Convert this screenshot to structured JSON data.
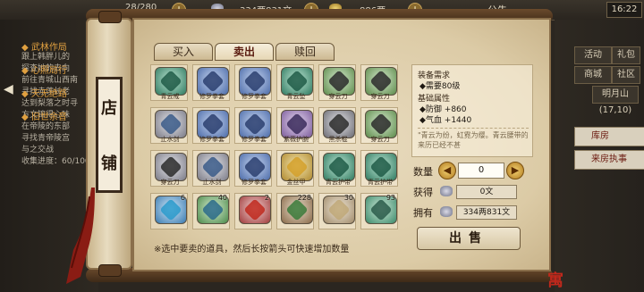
{
  "topbar": {
    "res1": "28/280",
    "money": "334两831文",
    "res3": "886两",
    "notice": "公告",
    "time": "16:22"
  },
  "quests": [
    {
      "title": "◆ 武林作局",
      "desc": "跟上韩胖儿的"
    },
    {
      "title": "",
      "desc": "探查她的去向"
    },
    {
      "title": "◆ 心照局行",
      "desc": "前往青城山西南"
    },
    {
      "title": "",
      "desc": "寻找赤莲长老"
    },
    {
      "title": "◆ 天无绝路",
      "desc": "达到梨落之时寻"
    },
    {
      "title": "",
      "desc": "方文锦得心味"
    },
    {
      "title": "◆ 旧世余音",
      "desc": "在帝陵的东部"
    },
    {
      "title": "",
      "desc": "寻找青帝陵宫"
    },
    {
      "title": "",
      "desc": "与之交战"
    },
    {
      "title": "",
      "desc": "收集进度：60/100"
    }
  ],
  "right_buttons": [
    "活动",
    "礼包",
    "商城",
    "社区",
    "明月山(17,10)"
  ],
  "right_buttons2": [
    "库房",
    "来房执事"
  ],
  "shop": {
    "title_chars": [
      "店",
      "铺"
    ],
    "tabs": [
      "买入",
      "卖出",
      "赎回"
    ],
    "items": [
      {
        "name": "青云戒",
        "count": ""
      },
      {
        "name": "修罗拳套",
        "count": ""
      },
      {
        "name": "修罗拳套",
        "count": ""
      },
      {
        "name": "青云坠",
        "count": ""
      },
      {
        "name": "穿云刀",
        "count": ""
      },
      {
        "name": "穿云刀",
        "count": ""
      },
      {
        "name": "止水剑",
        "count": ""
      },
      {
        "name": "修罗拳套",
        "count": ""
      },
      {
        "name": "修罗拳套",
        "count": ""
      },
      {
        "name": "紫薇护腕",
        "count": ""
      },
      {
        "name": "黑杀棍",
        "count": ""
      },
      {
        "name": "穿云刀",
        "count": ""
      },
      {
        "name": "穿云刀",
        "count": ""
      },
      {
        "name": "止水剑",
        "count": ""
      },
      {
        "name": "修罗拳套",
        "count": ""
      },
      {
        "name": "金丝甲",
        "count": ""
      },
      {
        "name": "青云护带",
        "count": ""
      },
      {
        "name": "青云护带",
        "count": ""
      },
      {
        "name": "",
        "count": "6"
      },
      {
        "name": "",
        "count": "40"
      },
      {
        "name": "",
        "count": "2"
      },
      {
        "name": "",
        "count": "228"
      },
      {
        "name": "",
        "count": "30"
      },
      {
        "name": "",
        "count": "93"
      }
    ],
    "detail": {
      "req_title": "装备需求",
      "req": "◆需要80级",
      "base_title": "基础属性",
      "attr1": "◆防御  +860",
      "attr2": "◆气血  +1440",
      "quote": "\"青云为纷，虹霓为缨。青云腰带的来历已经不甚"
    },
    "qty_label": "数量",
    "qty_value": "0",
    "gain_label": "获得",
    "gain_value": "0文",
    "own_label": "拥有",
    "own_value": "334两831文",
    "sell_label": "出售",
    "hint": "※选中要卖的道具，然后长按箭头可快速增加数量"
  },
  "colors": {
    "accent": "#c0281c"
  }
}
